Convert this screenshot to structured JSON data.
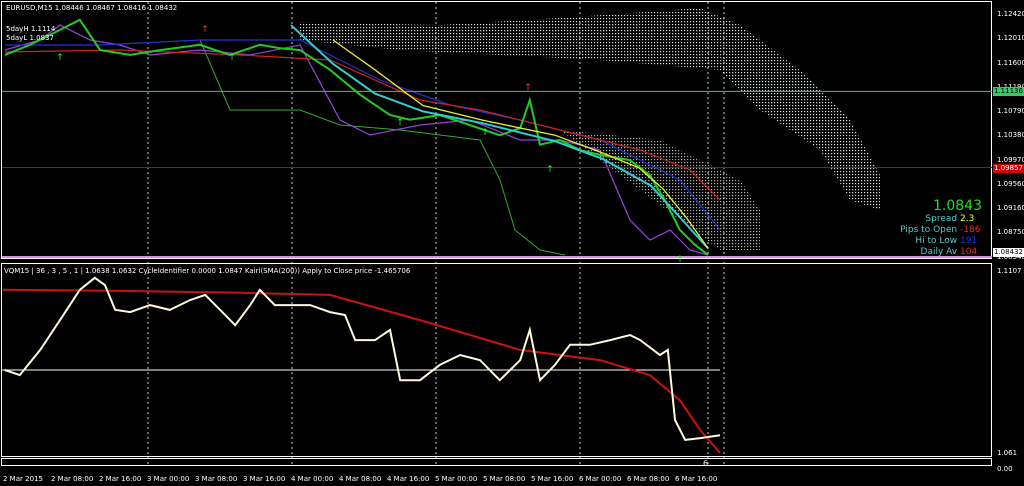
{
  "header": {
    "symbol_line": "EURUSD,M15  1.08446 1.08467 1.08416 1.08432",
    "label_high": "5dayH 1.1114",
    "label_low": "5dayL 1.0837"
  },
  "info_panel": {
    "price": "1.0843",
    "price_color": "#22dd22",
    "rows": [
      {
        "label": "Spread",
        "value": "2.3",
        "value_color": "#ffff33"
      },
      {
        "label": "Pips to Open",
        "value": "-186",
        "value_color": "#ee2222"
      },
      {
        "label": "Hi to Low",
        "value": "191",
        "value_color": "#2233dd"
      },
      {
        "label": "Daily Av",
        "value": "104",
        "value_color": "#ee2222"
      }
    ]
  },
  "price_axis": {
    "ticks": [
      "1.12420",
      "1.12010",
      "1.11600",
      "1.11190",
      "1.10790",
      "1.10380",
      "1.09970",
      "1.09560",
      "1.09160",
      "1.08750",
      "1.08340"
    ],
    "tick_values": [
      1.1242,
      1.1201,
      1.116,
      1.1119,
      1.1079,
      1.1038,
      1.0997,
      1.0956,
      1.0916,
      1.0875,
      1.0834
    ],
    "green_line": {
      "label": "1.11136",
      "value": 1.11136,
      "color": "#33cc66"
    },
    "red_line": {
      "label": "1.09857",
      "value": 1.09857,
      "color": "#cc0000"
    },
    "current": {
      "label": "1.08432",
      "value": 1.08432
    }
  },
  "indicator": {
    "title": "VQM15 | 36 , 3 , 5 , 1  | 1.0638 1.0632  CycleIdentifier 0.0000 1.0847  Kairi(SMA(200)) Apply to Close price -1.465706",
    "axis_top": "1.1107",
    "axis_bottom": "1.061",
    "level_value": 1.0838
  },
  "sub_pane": {
    "value": "6",
    "axis_label": "0.00"
  },
  "time_axis": [
    "2 Mar 2015",
    "2 Mar 08:00",
    "2 Mar 16:00",
    "3 Mar 00:00",
    "3 Mar 08:00",
    "3 Mar 16:00",
    "4 Mar 00:00",
    "4 Mar 08:00",
    "4 Mar 16:00",
    "5 Mar 00:00",
    "5 Mar 08:00",
    "5 Mar 16:00",
    "6 Mar 00:00",
    "6 Mar 08:00",
    "6 Mar 16:00"
  ],
  "chart_data": {
    "type": "line",
    "x_unit": "hours since 2 Mar 2015 00:00",
    "price_series": {
      "name": "EURUSD close",
      "color": "#22cc22",
      "t": [
        0.3,
        4.5,
        9.5,
        12.8,
        16.2,
        21.2,
        26.2,
        32.8,
        37.8,
        42.8,
        46.2,
        49.5,
        54.5,
        59.5,
        64.5,
        67.8,
        72.8,
        77.8,
        82.8,
        86.2,
        87.8,
        89.5,
        92.8,
        96.2,
        99.5,
        104.5,
        107.8,
        110.3,
        112.8,
        115.3,
        117.5
      ],
      "v": [
        1.1175,
        1.1192,
        1.1217,
        1.1234,
        1.1183,
        1.1175,
        1.1183,
        1.1192,
        1.1175,
        1.1192,
        1.1186,
        1.1183,
        1.115,
        1.1108,
        1.1074,
        1.1066,
        1.1074,
        1.1057,
        1.104,
        1.1052,
        1.1099,
        1.1024,
        1.1032,
        1.1015,
        1.1007,
        1.0998,
        1.0973,
        1.0931,
        1.0881,
        1.0856,
        1.0839
      ]
    },
    "ma_cyan": {
      "t": [
        48,
        55,
        62,
        70,
        80,
        92,
        100,
        108,
        113,
        117.5
      ],
      "v": [
        1.1225,
        1.116,
        1.111,
        1.108,
        1.106,
        1.103,
        1.1,
        1.0955,
        1.09,
        1.085
      ],
      "color": "#33cccc"
    },
    "ma_yellow": {
      "t": [
        55,
        62,
        70,
        80,
        92,
        100,
        106,
        110,
        114,
        117.5
      ],
      "v": [
        1.12,
        1.115,
        1.109,
        1.1065,
        1.104,
        1.101,
        1.0985,
        1.095,
        1.09,
        1.085
      ],
      "color": "#eeee22"
    },
    "vq_series": {
      "name": "VQ",
      "color": "#fff8dd",
      "t": [
        0.3,
        2.8,
        6.2,
        9.5,
        12.8,
        15.3,
        17,
        18.7,
        21.2,
        24.5,
        27.8,
        31.2,
        33.7,
        36.2,
        38.7,
        41.2,
        42.8,
        45.3,
        47.8,
        51.2,
        54.5,
        57,
        58.7,
        62,
        64.5,
        66.2,
        69.5,
        72.8,
        76.2,
        79.5,
        82.8,
        86.2,
        87.8,
        89.5,
        92,
        94.5,
        97.8,
        101.2,
        104.5,
        106.2,
        109.5,
        110.8,
        112,
        113.7,
        116.2,
        119.5
      ],
      "v": [
        1.0838,
        1.0824,
        1.0893,
        1.0975,
        1.1058,
        1.1091,
        1.1071,
        1.1003,
        1.0997,
        1.1016,
        1.1003,
        1.103,
        1.1044,
        1.1003,
        1.0961,
        1.1016,
        1.1058,
        1.1016,
        1.1016,
        1.1016,
        1.0997,
        1.0989,
        1.092,
        1.092,
        1.0948,
        1.081,
        1.081,
        1.0852,
        1.0879,
        1.0865,
        1.081,
        1.0865,
        1.0948,
        1.081,
        1.0852,
        1.0907,
        1.0907,
        1.092,
        1.0934,
        1.092,
        1.0879,
        1.0893,
        1.0701,
        1.0646,
        1.0651,
        1.0659
      ]
    },
    "sma200": {
      "name": "SMA(200)",
      "color": "#cc1111",
      "t": [
        0,
        20,
        40,
        54.5,
        69.5,
        86.2,
        99.5,
        107.8,
        112.8,
        116.2,
        119.5
      ],
      "v": [
        1.1058,
        1.1055,
        1.105,
        1.1044,
        1.0975,
        1.0893,
        1.0865,
        1.0824,
        1.0755,
        1.0673,
        1.061
      ]
    }
  }
}
